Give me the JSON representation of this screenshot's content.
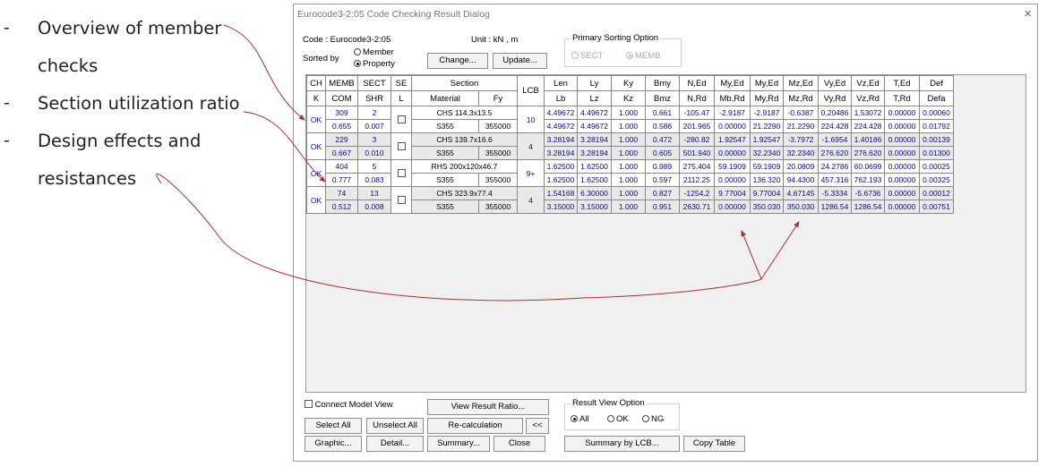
{
  "bullets": [
    {
      "dash": "-",
      "line1": "Overview of member",
      "line2": "checks"
    },
    {
      "dash": "-",
      "line1": "Section utilization ratio",
      "line2": ""
    },
    {
      "dash": "-",
      "line1": "Design effects and",
      "line2": "resistances"
    }
  ],
  "dialog": {
    "title": "Eurocode3-2:05 Code Checking Result Dialog",
    "close_glyph": "×",
    "code_label": "Code : Eurocode3-2:05",
    "unit_label": "Unit :  kN  ,   m",
    "sorted_by_label": "Sorted by",
    "sort_member": "Member",
    "sort_property": "Property",
    "change_button": "Change...",
    "update_button": "Update...",
    "primary_sort": {
      "title": "Primary Sorting Option",
      "sect": "SECT",
      "memb": "MEMB"
    }
  },
  "table": {
    "headers_row1": [
      "CH",
      "MEMB",
      "SECT",
      "SE",
      "Section",
      "LCB",
      "Len",
      "Ly",
      "Ky",
      "Bmy",
      "N,Ed",
      "My,Ed",
      "My,Ed",
      "Mz,Ed",
      "Vy,Ed",
      "Vz,Ed",
      "T,Ed",
      "Def"
    ],
    "headers_row2": [
      "K",
      "COM",
      "SHR",
      "L",
      "Material",
      "Fy",
      "Lb",
      "Lz",
      "Kz",
      "Bmz",
      "N,Rd",
      "Mb,Rd",
      "My,Rd",
      "Mz,Rd",
      "Vy,Rd",
      "Vz,Rd",
      "T,Rd",
      "Defa"
    ],
    "rows": [
      {
        "chk": "OK",
        "memb": "309",
        "sect": "2",
        "section": "CHS 114.3x13.5",
        "lcb": "10",
        "r1": [
          "4.49672",
          "4.49672",
          "1.000",
          "0.661",
          "-105.47",
          "-2.9187",
          "-2.9187",
          "-0.6387",
          "0.20486",
          "1.53072",
          "0.00000",
          "0.00060"
        ],
        "com": "0.655",
        "shr": "0.007",
        "material": "S355",
        "fy": "355000",
        "r2": [
          "4.49672",
          "4.49672",
          "1.000",
          "0.586",
          "201.965",
          "0.00000",
          "21.2290",
          "21.2290",
          "224.428",
          "224.428",
          "0.00000",
          "0.01792"
        ]
      },
      {
        "chk": "OK",
        "memb": "229",
        "sect": "3",
        "section": "CHS 139.7x16.6",
        "lcb": "4",
        "r1": [
          "3.28194",
          "3.28194",
          "1.000",
          "0.472",
          "-280.82",
          "1.92547",
          "1.92547",
          "-3.7972",
          "-1.6954",
          "1.40186",
          "0.00000",
          "0.00139"
        ],
        "com": "0.667",
        "shr": "0.010",
        "material": "S355",
        "fy": "355000",
        "r2": [
          "3.28194",
          "3.28194",
          "1.000",
          "0.605",
          "501.940",
          "0.00000",
          "32.2340",
          "32.2340",
          "276.620",
          "276.620",
          "0.00000",
          "0.01300"
        ]
      },
      {
        "chk": "OK",
        "memb": "404",
        "sect": "5",
        "section": "RHS 200x120x46.7",
        "lcb": "9+",
        "r1": [
          "1.62500",
          "1.62500",
          "1.000",
          "0.989",
          "275.404",
          "59.1909",
          "59.1909",
          "20.0809",
          "24.2786",
          "60.0699",
          "0.00000",
          "0.00025"
        ],
        "com": "0.777",
        "shr": "0.083",
        "material": "S355",
        "fy": "355000",
        "r2": [
          "1.62500",
          "1.62500",
          "1.000",
          "0.597",
          "2112.25",
          "0.00000",
          "136.320",
          "94.4300",
          "457.316",
          "762.193",
          "0.00000",
          "0.00325"
        ]
      },
      {
        "chk": "OK",
        "memb": "74",
        "sect": "13",
        "section": "CHS 323.9x77.4",
        "lcb": "4",
        "r1": [
          "1.54168",
          "6.30000",
          "1.000",
          "0.827",
          "-1254.2",
          "9.77004",
          "9.77004",
          "4.67145",
          "-5.3334",
          "-5.6736",
          "0.00000",
          "0.00012"
        ],
        "com": "0.512",
        "shr": "0.008",
        "material": "S355",
        "fy": "355000",
        "r2": [
          "3.15000",
          "3.15000",
          "1.000",
          "0.951",
          "2630.71",
          "0.00000",
          "350.030",
          "350.030",
          "1286.54",
          "1286.54",
          "0.00000",
          "0.00751"
        ]
      }
    ]
  },
  "bottom": {
    "connect_model_view": "Connect Model View",
    "view_result_ratio": "View Result Ratio...",
    "select_all": "Select All",
    "unselect_all": "Unselect All",
    "recalculation": "Re-calculation",
    "collapse": "<<",
    "graphic": "Graphic...",
    "detail": "Detail...",
    "summary": "Summary...",
    "close": "Close",
    "result_view_option": {
      "title": "Result View Option",
      "all": "All",
      "ok": "OK",
      "ng": "NG"
    },
    "summary_by_lcb": "Summary by LCB...",
    "copy_table": "Copy Table"
  },
  "colors": {
    "arrow": "#b03030",
    "value_text": "#0a0a8a"
  }
}
